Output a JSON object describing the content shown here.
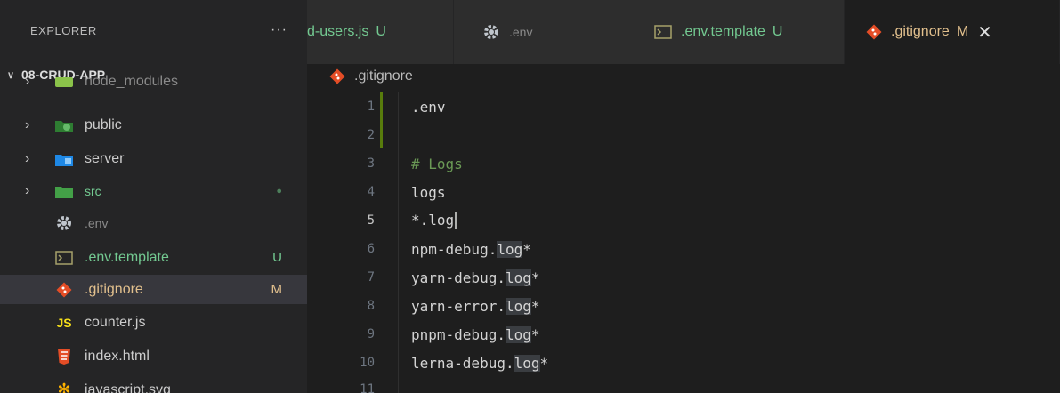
{
  "explorer": {
    "title": "EXPLORER",
    "more": "···",
    "root": "08-CRUD-APP",
    "items": [
      {
        "label": "node_modules",
        "icon": "node-modules-folder-icon"
      },
      {
        "label": "public",
        "icon": "public-folder-icon"
      },
      {
        "label": "server",
        "icon": "server-folder-icon"
      },
      {
        "label": "src",
        "icon": "src-folder-icon",
        "badge": "●"
      },
      {
        "label": ".env",
        "icon": "gear-icon"
      },
      {
        "label": ".env.template",
        "icon": "terminal-icon",
        "badge": "U"
      },
      {
        "label": ".gitignore",
        "icon": "git-icon",
        "badge": "M"
      },
      {
        "label": "counter.js",
        "icon": "js-icon"
      },
      {
        "label": "index.html",
        "icon": "html-icon"
      },
      {
        "label": "javascript.svg",
        "icon": "svg-icon"
      }
    ]
  },
  "tabs": [
    {
      "label": "d-users.js",
      "status": "U"
    },
    {
      "label": ".env",
      "status": ""
    },
    {
      "label": ".env.template",
      "status": "U"
    },
    {
      "label": ".gitignore",
      "status": "M",
      "close": "✕"
    }
  ],
  "breadcrumb": {
    "file": ".gitignore"
  },
  "editor": {
    "lines": [
      {
        "n": "1",
        "text": ".env"
      },
      {
        "n": "2",
        "text": ""
      },
      {
        "n": "3",
        "text": "# Logs"
      },
      {
        "n": "4",
        "text": "logs"
      },
      {
        "n": "5",
        "text": "*.log"
      },
      {
        "n": "6",
        "pre": "npm-debug.",
        "hl": "log",
        "post": "*"
      },
      {
        "n": "7",
        "pre": "yarn-debug.",
        "hl": "log",
        "post": "*"
      },
      {
        "n": "8",
        "pre": "yarn-error.",
        "hl": "log",
        "post": "*"
      },
      {
        "n": "9",
        "pre": "pnpm-debug.",
        "hl": "log",
        "post": "*"
      },
      {
        "n": "10",
        "pre": "lerna-debug.",
        "hl": "log",
        "post": "*"
      },
      {
        "n": "11",
        "text": ""
      }
    ]
  },
  "colors": {
    "accent_green": "#73c991",
    "modified": "#e2c08d",
    "git_orange": "#e44d26",
    "comment": "#6a9955"
  }
}
